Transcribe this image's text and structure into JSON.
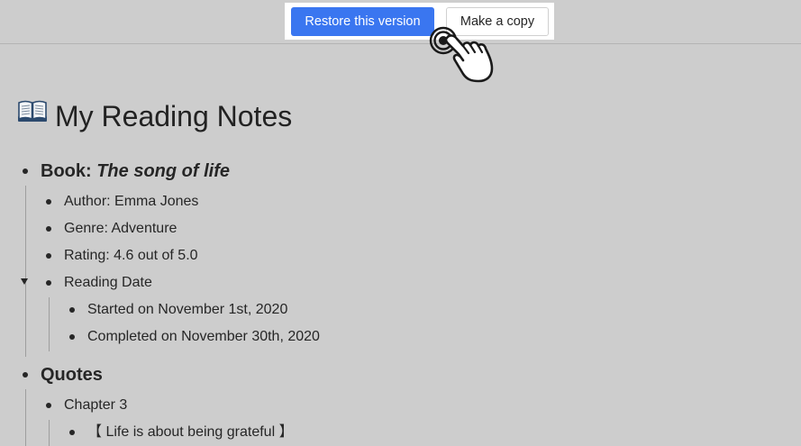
{
  "toolbar": {
    "restore_label": "Restore this version",
    "copy_label": "Make a copy",
    "accent_color": "#3a76f0"
  },
  "page": {
    "title_icon": "open-book-icon",
    "title": "My Reading Notes"
  },
  "outline": {
    "book_label": "Book: ",
    "book_title": "The song of life",
    "book_items": [
      "Author: Emma Jones",
      "Genre: Adventure",
      "Rating: 4.6 out of 5.0"
    ],
    "reading_date": {
      "label": "Reading Date",
      "collapsed": false,
      "items": [
        "Started on November 1st, 2020",
        "Completed on November 30th, 2020"
      ]
    },
    "quotes_label": "Quotes",
    "chapter": {
      "label": "Chapter 3",
      "items": [
        "【 Life is about being grateful 】"
      ]
    }
  },
  "cursor_icon": "hand-pointer-click-icon"
}
